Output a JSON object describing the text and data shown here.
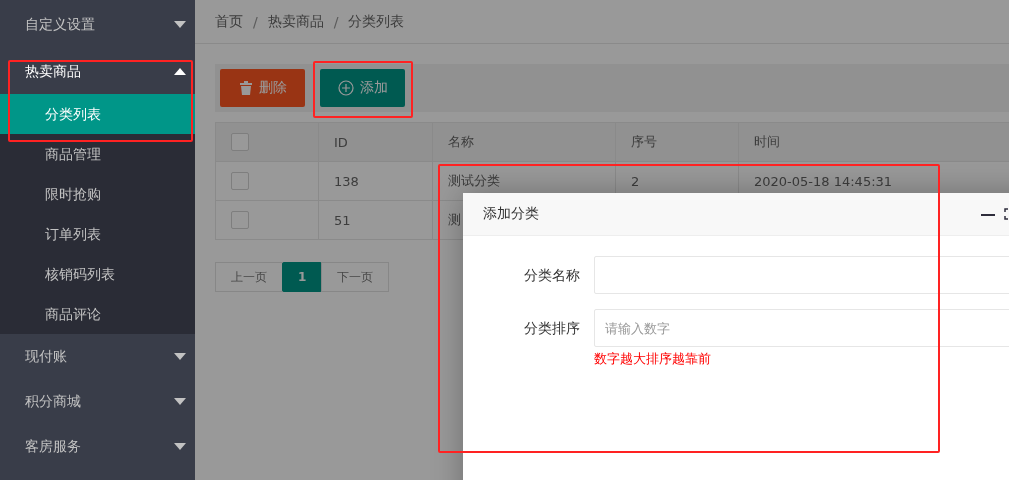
{
  "sidebar": {
    "menus": [
      {
        "label": "自定义设置",
        "expanded": false
      },
      {
        "label": "热卖商品",
        "expanded": true,
        "children": [
          {
            "label": "分类列表",
            "selected": true
          },
          {
            "label": "商品管理",
            "selected": false
          },
          {
            "label": "限时抢购",
            "selected": false
          },
          {
            "label": "订单列表",
            "selected": false
          },
          {
            "label": "核销码列表",
            "selected": false
          },
          {
            "label": "商品评论",
            "selected": false
          }
        ]
      },
      {
        "label": "现付账",
        "expanded": false
      },
      {
        "label": "积分商城",
        "expanded": false
      },
      {
        "label": "客房服务",
        "expanded": false
      }
    ]
  },
  "breadcrumb": {
    "separator": "/",
    "items": [
      "首页",
      "热卖商品",
      "分类列表"
    ]
  },
  "toolbar": {
    "buttons": [
      {
        "label": "删除",
        "kind": "danger"
      },
      {
        "label": "添加",
        "kind": "primary"
      }
    ]
  },
  "table": {
    "header_checked": false,
    "columns": [
      "ID",
      "名称",
      "序号",
      "时间"
    ],
    "rows": [
      {
        "checked": false,
        "cells": [
          "138",
          "测试分类",
          "2",
          "2020-05-18 14:45:31"
        ]
      },
      {
        "checked": false,
        "cells": [
          "51",
          "测"
        ]
      }
    ]
  },
  "pagination": {
    "prev": {
      "label": "上一页",
      "disabled": true
    },
    "pages": [
      {
        "label": "1",
        "selected": true
      }
    ],
    "next": {
      "label": "下一页",
      "disabled": true
    }
  },
  "dialog": {
    "title": "添加分类",
    "fields": [
      {
        "label": "分类名称"
      },
      {
        "label": "分类排序",
        "placeholder": "请输入数字",
        "hint": "数字越大排序越靠前"
      }
    ]
  }
}
